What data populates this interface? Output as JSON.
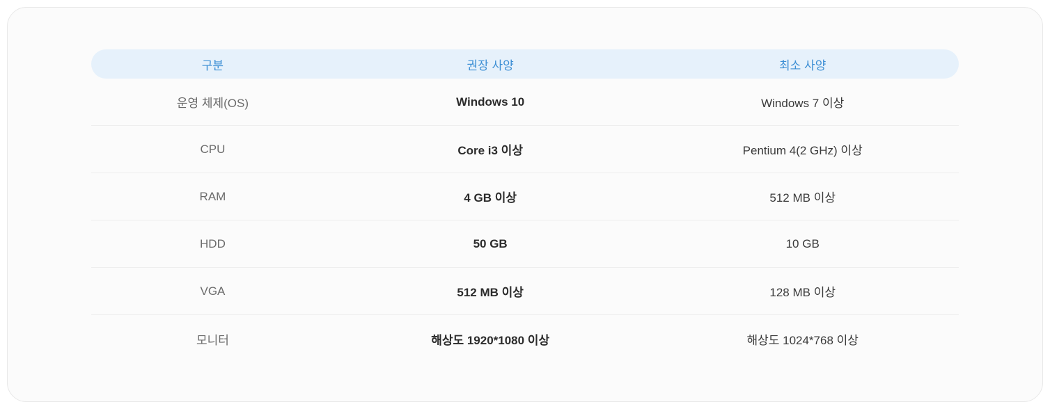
{
  "headers": {
    "category": "구분",
    "recommended": "권장 사양",
    "minimum": "최소 사양"
  },
  "rows": [
    {
      "category": "운영 체제(OS)",
      "recommended": "Windows 10",
      "minimum": "Windows 7 이상"
    },
    {
      "category": "CPU",
      "recommended": "Core i3 이상",
      "minimum": "Pentium 4(2 GHz) 이상"
    },
    {
      "category": "RAM",
      "recommended": "4 GB 이상",
      "minimum": "512 MB 이상"
    },
    {
      "category": "HDD",
      "recommended": "50 GB",
      "minimum": "10 GB"
    },
    {
      "category": "VGA",
      "recommended": "512 MB 이상",
      "minimum": "128 MB 이상"
    },
    {
      "category": "모니터",
      "recommended": "해상도 1920*1080 이상",
      "minimum": "해상도 1024*768 이상"
    }
  ]
}
